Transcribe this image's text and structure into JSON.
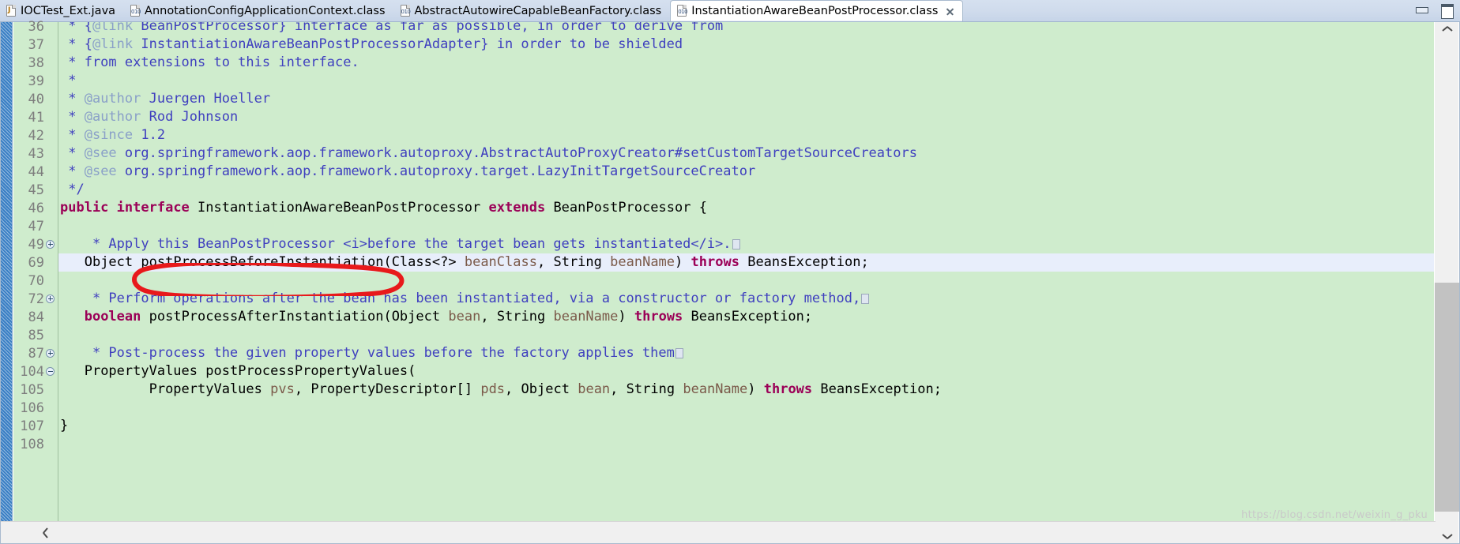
{
  "window": {
    "minimize_label": "Minimize",
    "maximize_label": "Restore"
  },
  "tabs": [
    {
      "label": "IOCTest_Ext.java",
      "icon": "java-file-icon",
      "active": false,
      "closable": false
    },
    {
      "label": "AnnotationConfigApplicationContext.class",
      "icon": "class-file-icon",
      "active": false,
      "closable": false
    },
    {
      "label": "AbstractAutowireCapableBeanFactory.class",
      "icon": "class-file-icon",
      "active": false,
      "closable": false
    },
    {
      "label": "InstantiationAwareBeanPostProcessor.class",
      "icon": "class-file-icon",
      "active": true,
      "closable": true
    }
  ],
  "editor": {
    "highlighted_line": 69,
    "annotation": {
      "type": "hand-drawn-oval",
      "color": "#e8191b",
      "encircles": "postProcessBeforeInstantiation"
    },
    "lines": [
      {
        "num": "36",
        "fold": "none",
        "text": " * {@link BeanPostProcessor} interface as far as possible, in order to derive from"
      },
      {
        "num": "37",
        "fold": "none",
        "text": " * {@link InstantiationAwareBeanPostProcessorAdapter} in order to be shielded"
      },
      {
        "num": "38",
        "fold": "none",
        "text": " * from extensions to this interface."
      },
      {
        "num": "39",
        "fold": "none",
        "text": " *"
      },
      {
        "num": "40",
        "fold": "none",
        "text": " * @author Juergen Hoeller"
      },
      {
        "num": "41",
        "fold": "none",
        "text": " * @author Rod Johnson"
      },
      {
        "num": "42",
        "fold": "none",
        "text": " * @since 1.2"
      },
      {
        "num": "43",
        "fold": "none",
        "text": " * @see org.springframework.aop.framework.autoproxy.AbstractAutoProxyCreator#setCustomTargetSourceCreators"
      },
      {
        "num": "44",
        "fold": "none",
        "text": " * @see org.springframework.aop.framework.autoproxy.target.LazyInitTargetSourceCreator"
      },
      {
        "num": "45",
        "fold": "none",
        "text": " */"
      },
      {
        "num": "46",
        "fold": "none",
        "text": "public interface InstantiationAwareBeanPostProcessor extends BeanPostProcessor {"
      },
      {
        "num": "47",
        "fold": "none",
        "text": ""
      },
      {
        "num": "49",
        "fold": "plus",
        "text": "    * Apply this BeanPostProcessor <i>before the target bean gets instantiated</i>."
      },
      {
        "num": "69",
        "fold": "none",
        "text": "   Object postProcessBeforeInstantiation(Class<?> beanClass, String beanName) throws BeansException;"
      },
      {
        "num": "70",
        "fold": "none",
        "text": ""
      },
      {
        "num": "72",
        "fold": "plus",
        "text": "    * Perform operations after the bean has been instantiated, via a constructor or factory method,"
      },
      {
        "num": "84",
        "fold": "none",
        "text": "   boolean postProcessAfterInstantiation(Object bean, String beanName) throws BeansException;"
      },
      {
        "num": "85",
        "fold": "none",
        "text": ""
      },
      {
        "num": "87",
        "fold": "plus",
        "text": "    * Post-process the given property values before the factory applies them"
      },
      {
        "num": "104",
        "fold": "minus",
        "text": "   PropertyValues postProcessPropertyValues("
      },
      {
        "num": "105",
        "fold": "none",
        "text": "           PropertyValues pvs, PropertyDescriptor[] pds, Object bean, String beanName) throws BeansException;"
      },
      {
        "num": "106",
        "fold": "none",
        "text": ""
      },
      {
        "num": "107",
        "fold": "none",
        "text": "}"
      },
      {
        "num": "108",
        "fold": "none",
        "text": ""
      }
    ]
  },
  "scrollbars": {
    "vertical_up_label": "Scroll up",
    "vertical_down_label": "Scroll down",
    "horizontal_left_label": "Scroll left"
  },
  "watermark": "https://blog.csdn.net/weixin_g_pku"
}
